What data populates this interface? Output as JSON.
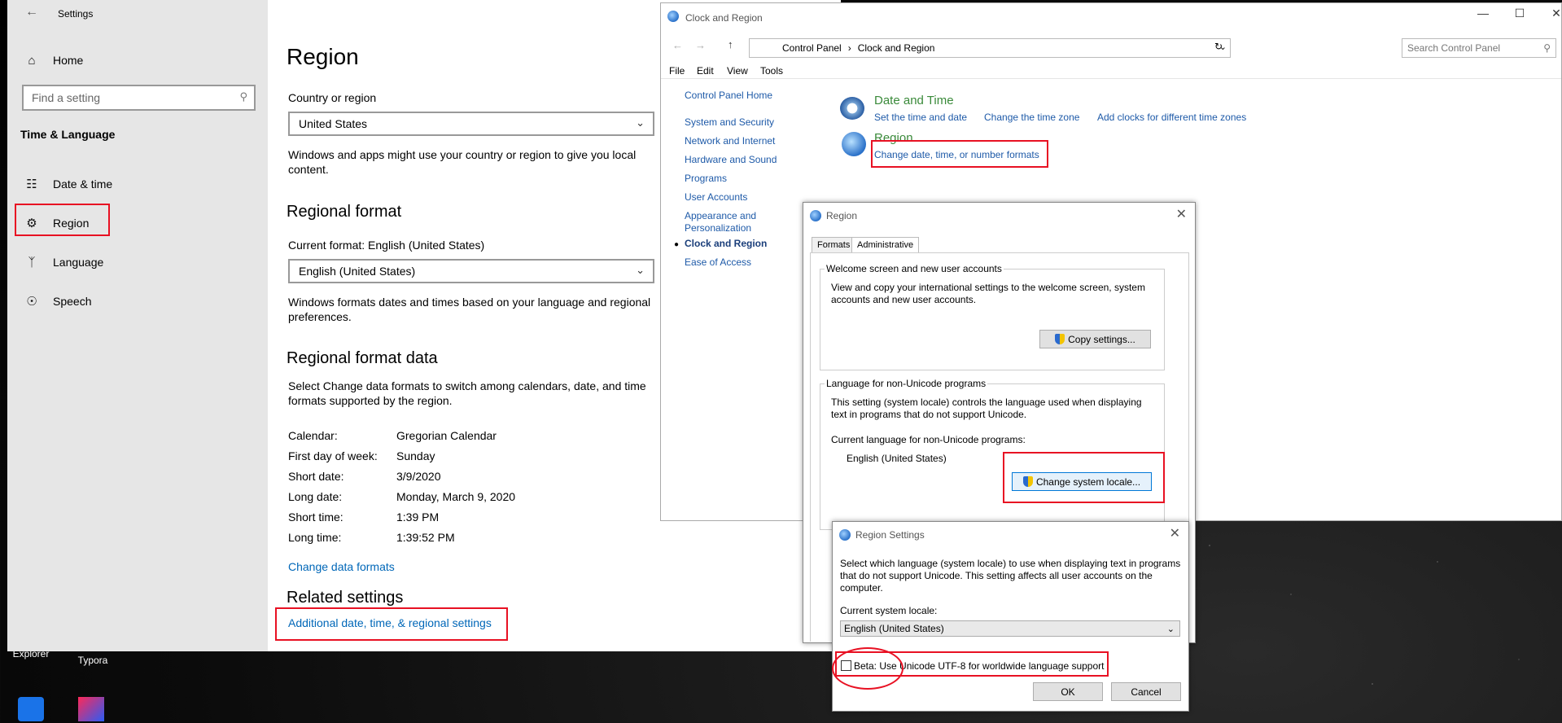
{
  "settings": {
    "title": "Settings",
    "nav_home": "Home",
    "search_placeholder": "Find a setting",
    "section_header": "Time & Language",
    "nav_items": [
      "Date & time",
      "Region",
      "Language",
      "Speech"
    ],
    "page_title": "Region",
    "country_label": "Country or region",
    "country_value": "United States",
    "country_help": "Windows and apps might use your country or region to give you local content.",
    "format_heading": "Regional format",
    "current_format": "Current format: English (United States)",
    "format_value": "English (United States)",
    "format_help": "Windows formats dates and times based on your language and regional preferences.",
    "data_heading": "Regional format data",
    "data_help": "Select Change data formats to switch among calendars, date, and time formats supported by the region.",
    "data_rows": [
      {
        "label": "Calendar:",
        "value": "Gregorian Calendar"
      },
      {
        "label": "First day of week:",
        "value": "Sunday"
      },
      {
        "label": "Short date:",
        "value": "3/9/2020"
      },
      {
        "label": "Long date:",
        "value": "Monday, March 9, 2020"
      },
      {
        "label": "Short time:",
        "value": "1:39 PM"
      },
      {
        "label": "Long time:",
        "value": "1:39:52 PM"
      }
    ],
    "change_link": "Change data formats",
    "related_heading": "Related settings",
    "related_link": "Additional date, time, & regional settings"
  },
  "control_panel": {
    "title": "Clock and Region",
    "breadcrumb": [
      "Control Panel",
      "Clock and Region"
    ],
    "search_placeholder": "Search Control Panel",
    "menu": [
      "File",
      "Edit",
      "View",
      "Tools"
    ],
    "left_nav": [
      "Control Panel Home",
      "System and Security",
      "Network and Internet",
      "Hardware and Sound",
      "Programs",
      "User Accounts",
      "Appearance and Personalization",
      "Clock and Region",
      "Ease of Access"
    ],
    "cat_datetime": "Date and Time",
    "tasks_datetime": [
      "Set the time and date",
      "Change the time zone",
      "Add clocks for different time zones"
    ],
    "cat_region": "Region",
    "task_region": "Change date, time, or number formats"
  },
  "region_dialog": {
    "title": "Region",
    "tabs": [
      "Formats",
      "Administrative"
    ],
    "welcome_group": "Welcome screen and new user accounts",
    "welcome_text": "View and copy your international settings to the welcome screen, system accounts and new user accounts.",
    "copy_button": "Copy settings...",
    "unicode_group": "Language for non-Unicode programs",
    "unicode_text": "This setting (system locale) controls the language used when displaying text in programs that do not support Unicode.",
    "current_label": "Current language for non-Unicode programs:",
    "current_value": "English (United States)",
    "change_button": "Change system locale..."
  },
  "region_settings": {
    "title": "Region Settings",
    "text": "Select which language (system locale) to use when displaying text in programs that do not support Unicode. This setting affects all user accounts on the computer.",
    "locale_label": "Current system locale:",
    "locale_value": "English (United States)",
    "beta_label": "Beta: Use Unicode UTF-8 for worldwide language support",
    "ok": "OK",
    "cancel": "Cancel"
  },
  "desktop": {
    "icons": [
      "Internet Explorer",
      "Typora"
    ]
  },
  "colors": {
    "accent": "#0067b8",
    "highlight": "#e81123"
  }
}
